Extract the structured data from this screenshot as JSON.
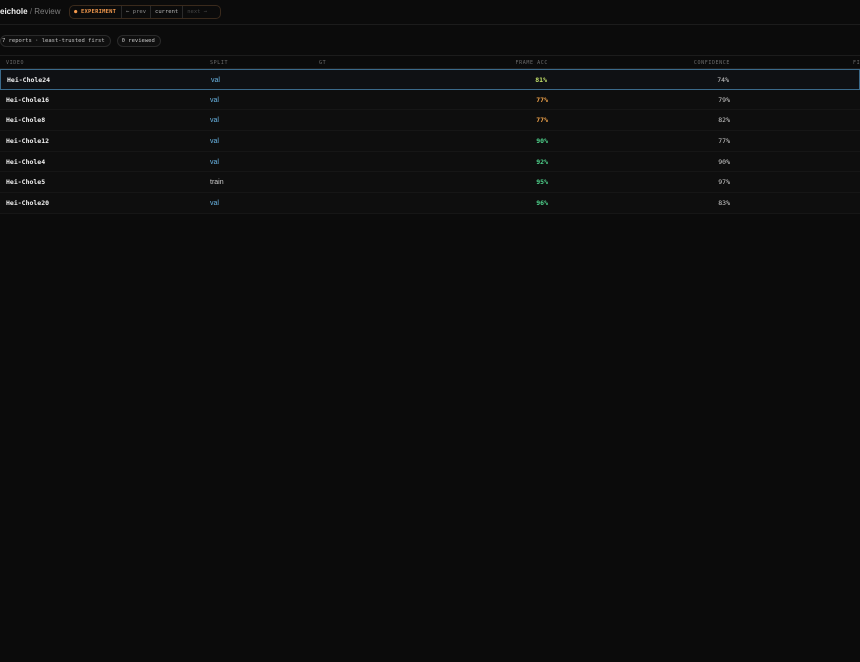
{
  "header": {
    "app_name": "eichole",
    "separator": "/",
    "page": "Review"
  },
  "experiment": {
    "label": "● EXPERIMENT",
    "prev": "← prev",
    "current": "current",
    "next": "next →"
  },
  "chips": {
    "reports": "7 reports · least-trusted first",
    "reviewed": "0 reviewed"
  },
  "columns": {
    "video": "VIDEO",
    "split": "SPLIT",
    "gt": "GT",
    "frame_acc": "FRAME ACC",
    "confidence": "CONFIDENCE",
    "last": "FI"
  },
  "colors": {
    "val": "#6ab6e6",
    "train": "#cfcfcf",
    "acc_low": "#f2a44b",
    "acc_mid": "#c4e26a",
    "acc_high": "#4fd38c"
  },
  "rows": [
    {
      "video": "Hei-Chole24",
      "split": "val",
      "frame_acc": "81%",
      "confidence": "74%",
      "acc_color": "#c4e26a",
      "split_color": "#6ab6e6"
    },
    {
      "video": "Hei-Chole16",
      "split": "val",
      "frame_acc": "77%",
      "confidence": "79%",
      "acc_color": "#f2a44b",
      "split_color": "#6ab6e6"
    },
    {
      "video": "Hei-Chole8",
      "split": "val",
      "frame_acc": "77%",
      "confidence": "82%",
      "acc_color": "#f2a44b",
      "split_color": "#6ab6e6"
    },
    {
      "video": "Hei-Chole12",
      "split": "val",
      "frame_acc": "90%",
      "confidence": "77%",
      "acc_color": "#4fd38c",
      "split_color": "#6ab6e6"
    },
    {
      "video": "Hei-Chole4",
      "split": "val",
      "frame_acc": "92%",
      "confidence": "90%",
      "acc_color": "#4fd38c",
      "split_color": "#6ab6e6"
    },
    {
      "video": "Hei-Chole5",
      "split": "train",
      "frame_acc": "95%",
      "confidence": "97%",
      "acc_color": "#4fd38c",
      "split_color": "#cfcfcf"
    },
    {
      "video": "Hei-Chole20",
      "split": "val",
      "frame_acc": "96%",
      "confidence": "83%",
      "acc_color": "#4fd38c",
      "split_color": "#6ab6e6"
    }
  ]
}
